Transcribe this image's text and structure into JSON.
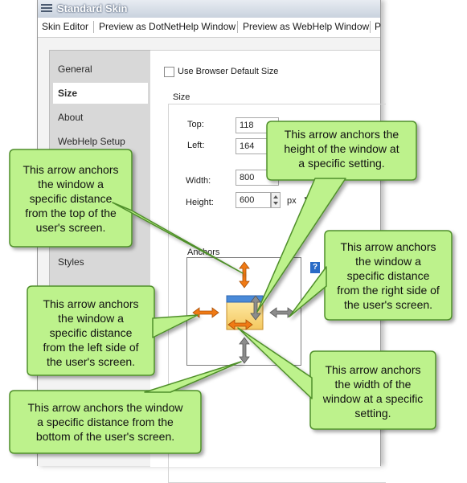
{
  "window": {
    "title": "Standard Skin"
  },
  "tabs": [
    "Skin Editor",
    "Preview as DotNetHelp Window",
    "Preview as WebHelp Window",
    "P"
  ],
  "sidebar": {
    "items": [
      "General",
      "Size",
      "About",
      "WebHelp Setup",
      "Styles"
    ]
  },
  "content": {
    "use_default_size_label": "Use Browser Default Size",
    "size_group_label": "Size",
    "top_label": "Top:",
    "top_value": "118",
    "left_label": "Left:",
    "left_value": "164",
    "width_label": "Width:",
    "width_value": "800",
    "height_label": "Height:",
    "height_value": "600",
    "height_unit": "px",
    "anchors_label": "Anchors",
    "help_icon_text": "?"
  },
  "callouts": {
    "top": [
      "This arrow anchors",
      "the window a",
      "specific distance",
      "from the top of the",
      "user's screen."
    ],
    "height": [
      "This arrow anchors the",
      "height of the window at",
      "a specific setting."
    ],
    "right": [
      "This arrow anchors",
      "the window a",
      "specific distance",
      "from the right side of",
      "the user's screen."
    ],
    "left": [
      "This arrow anchors",
      "the window a",
      "specific distance",
      "from the left side of",
      "the user's screen."
    ],
    "width": [
      "This arrow anchors",
      "the width of the",
      "window at a specific",
      "setting."
    ],
    "bottom": [
      "This arrow anchors the window",
      "a specific distance from the",
      "bottom of the user's screen."
    ]
  },
  "colors": {
    "callout_fill": "#bdf28c",
    "callout_border": "#4f8f2a",
    "arrow_active": "#f07a14",
    "arrow_inactive": "#8c8c8c"
  }
}
